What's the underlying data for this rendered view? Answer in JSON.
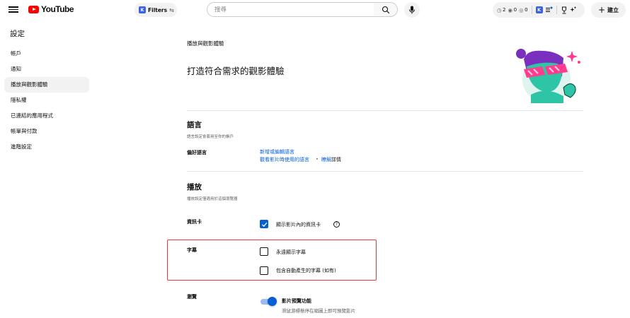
{
  "header": {
    "logo_text": "YouTube",
    "filters": {
      "badge": "K",
      "label": "Filters",
      "sort_glyph": "⇆"
    },
    "search": {
      "placeholder": "搜尋"
    },
    "stats": [
      {
        "icon": "clock-icon",
        "glyph": "◷",
        "value": "2"
      },
      {
        "icon": "eye-icon",
        "glyph": "◉",
        "value": "0"
      },
      {
        "icon": "eye-off-icon",
        "glyph": "◎",
        "value": "0"
      }
    ],
    "create_label": "建立",
    "create_plus": "+"
  },
  "sidebar": {
    "title": "設定",
    "items": [
      {
        "label": "帳戶"
      },
      {
        "label": "通知"
      },
      {
        "label": "播放與觀影體驗",
        "active": true
      },
      {
        "label": "隱私權"
      },
      {
        "label": "已連結的應用程式"
      },
      {
        "label": "帳單與付款"
      },
      {
        "label": "進階設定"
      }
    ]
  },
  "main": {
    "page_small_title": "播放與觀影體驗",
    "page_big_title": "打造符合需求的觀影體驗",
    "language": {
      "heading": "語言",
      "description": "語言設定會套用至你的帳戶",
      "pref_label": "偏好語言",
      "link_add": "新增或編輯語言",
      "link_used": "觀看影片時使用的語言",
      "bullet": "•",
      "link_learn": "瞭解",
      "learn_suffix": "詳情"
    },
    "playback": {
      "heading": "播放",
      "description": "播放設定僅適用於這個瀏覽器",
      "cards_label": "資訊卡",
      "cards_option": "顯示影片內的資訊卡",
      "cards_checked": true,
      "help_glyph": "?",
      "captions_label": "字幕",
      "captions_always": "永遠顯示字幕",
      "captions_always_checked": false,
      "captions_auto": "包含自動產生的字幕 (如有)",
      "captions_auto_checked": false,
      "browse_label": "瀏覽",
      "preview_title": "影片預覽功能",
      "preview_desc": "滑鼠游標懸停在縮圖上即可預覽影片",
      "preview_on": true
    }
  },
  "colors": {
    "accent": "#065fd4",
    "highlight_border": "#e53935",
    "brand_red": "#ff0000"
  }
}
